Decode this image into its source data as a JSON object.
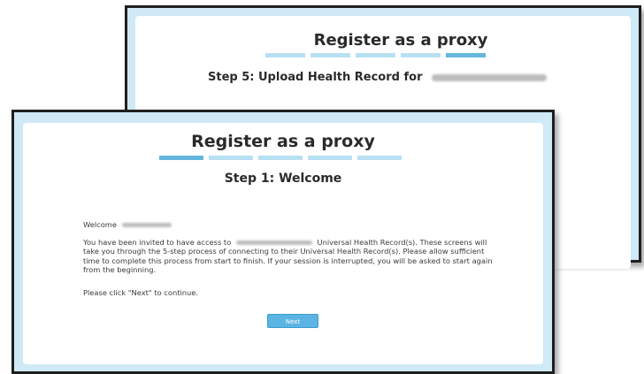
{
  "back_window": {
    "title": "Register as a proxy",
    "step_heading": "Step 5: Upload Health Record for"
  },
  "front_window": {
    "title": "Register as a proxy",
    "step_heading": "Step 1: Welcome",
    "welcome_label": "Welcome",
    "intro_before_name": "You have been invited to have access to",
    "intro_after_name": "Universal Health Record(s). These screens will take you through the 5-step process of connecting to their Universal Health Record(s). Please allow sufficient time to complete this process from start to finish. If your session is interrupted, you will be asked to start again from the beginning.",
    "continue_text": "Please click \"Next\" to continue.",
    "next_button": "Next"
  },
  "progress": {
    "total_steps": 5,
    "back_window_current_step": 5,
    "front_window_current_step": 1
  },
  "colors": {
    "frame_background": "#cfe9f7",
    "step_active": "#66b7df",
    "step_inactive": "#b8e0f3",
    "button": "#5bb4e3"
  }
}
